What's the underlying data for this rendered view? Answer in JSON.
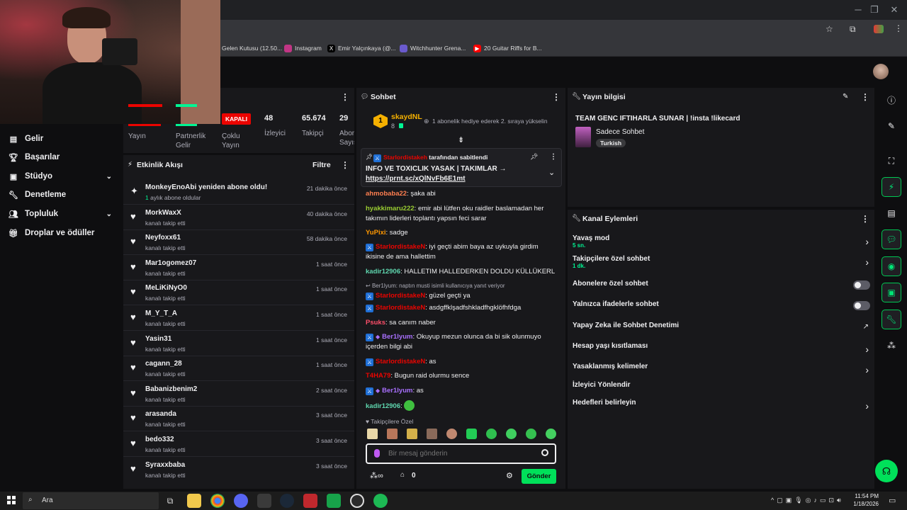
{
  "bookmarks": [
    "Gelen Kutusu (12.50...",
    "Instagram",
    "Emir Yalçınkaya (@...",
    "Witchhunter Grena...",
    "20 Guitar Riffs for B..."
  ],
  "nav": [
    {
      "label": "Gelir",
      "icon": "money-icon"
    },
    {
      "label": "Başarılar",
      "icon": "trophy-icon"
    },
    {
      "label": "Stüdyo",
      "icon": "studio-icon"
    },
    {
      "label": "Denetleme",
      "icon": "wrench-icon"
    },
    {
      "label": "Topluluk",
      "icon": "people-icon"
    },
    {
      "label": "Droplar ve ödüller",
      "icon": "gift-icon"
    }
  ],
  "stats": {
    "yayin_label": "Yayın",
    "partner_label": "Partnerlik Gelir",
    "multi_badge": "KAPALI",
    "multi_label": "Çoklu Yayın",
    "viewers_value": "48",
    "viewers_label": "İzleyici",
    "followers_value": "65.674",
    "followers_label": "Takipçi",
    "subs_value": "29",
    "subs_label": "Abon Sayıs"
  },
  "activity": {
    "title": "Etkinlik Akışı",
    "filter": "Filtre",
    "items": [
      {
        "name": "MonkeyEnoAbi yeniden abone oldu!",
        "sub": "1 aylık abone oldular",
        "time": "21 dakika önce"
      },
      {
        "name": "MorkWaxX",
        "sub": "kanalı takip etti",
        "time": "40 dakika önce"
      },
      {
        "name": "Neyfoxx61",
        "sub": "kanalı takip etti",
        "time": "58 dakika önce"
      },
      {
        "name": "Mar1ogomez07",
        "sub": "kanalı takip etti",
        "time": "1 saat önce"
      },
      {
        "name": "MeLiKiNyO0",
        "sub": "kanalı takip etti",
        "time": "1 saat önce"
      },
      {
        "name": "M_Y_T_A",
        "sub": "kanalı takip etti",
        "time": "1 saat önce"
      },
      {
        "name": "Yasin31",
        "sub": "kanalı takip etti",
        "time": "1 saat önce"
      },
      {
        "name": "cagann_28",
        "sub": "kanalı takip etti",
        "time": "1 saat önce"
      },
      {
        "name": "Babanizbenim2",
        "sub": "kanalı takip etti",
        "time": "2 saat önce"
      },
      {
        "name": "arasanda",
        "sub": "kanalı takip etti",
        "time": "3 saat önce"
      },
      {
        "name": "bedo332",
        "sub": "kanalı takip etti",
        "time": "3 saat önce"
      },
      {
        "name": "Syraxxbaba",
        "sub": "kanalı takip etti",
        "time": "3 saat önce"
      }
    ]
  },
  "chat": {
    "title": "Sohbet",
    "hype_rank": "1",
    "hype_user": "skaydNL",
    "hype_count": "8",
    "hype_text": "1 abonelik hediye ederek 2. sıraya yükselin",
    "pin_by": "Starlordistakeh",
    "pin_by_suffix": "tarafından sabitlendi",
    "pin_text": "INFO VE TOXICLIK YASAK | TAKIMLAR →",
    "pin_link": "https://prnt.sc/xQlNvFb6E1mt",
    "messages": [
      {
        "user": "ahmobaba22",
        "color": "#ff7f50",
        "badge": false,
        "text": "şaka abi"
      },
      {
        "user": "hyakkimaru222",
        "color": "#9acd32",
        "badge": false,
        "text": "emir abi lütfen oku raidler baslamadan her takımın liderleri toplantı yapsın feci sarar"
      },
      {
        "user": "YuPixi",
        "color": "#ff9800",
        "badge": false,
        "text": "sadge"
      },
      {
        "user": "StarlordistakeN",
        "color": "#eb0400",
        "badge": true,
        "text": "iyi geçti abim baya az uykuyla girdim ikisine de ama hallettim"
      },
      {
        "user": "kadir12906",
        "color": "#5fd7af",
        "badge": false,
        "text": "HALLETIM HALLEDERKEN DOLDU KÜLLÜKERL"
      },
      {
        "user": "StarlordistakeN",
        "color": "#eb0400",
        "badge": true,
        "text": "güzel geçti ya",
        "reply": "Ber1lyum: naptın musti isimli kullanıcıya yanıt veriyor"
      },
      {
        "user": "StarlordistakeN",
        "color": "#eb0400",
        "badge": true,
        "text": "asdgffklşadfshkladfhgklöfhfdga"
      },
      {
        "user": "Psuks",
        "color": "#ff4f6a",
        "badge": false,
        "text": "sa canım naber"
      },
      {
        "user": "Ber1lyum",
        "color": "#a970ff",
        "badge": true,
        "text": "Okuyup mezun olunca da bi sik olunmuyo içerden bilgi abi"
      },
      {
        "user": "StarlordistakeN",
        "color": "#eb0400",
        "badge": true,
        "text": "as"
      },
      {
        "user": "T4HA79",
        "color": "#eb0400",
        "badge": false,
        "text": "Bugun raid olurmu sence"
      },
      {
        "user": "Ber1lyum",
        "color": "#a970ff",
        "badge": true,
        "text": "as"
      },
      {
        "user": "kadir12906",
        "color": "#5fd7af",
        "badge": false,
        "text": ""
      }
    ],
    "follower_only": "Takipçilere Özel",
    "input_placeholder": "Bir mesaj gönderin",
    "points": "0",
    "send": "Gönder"
  },
  "stream_info": {
    "title": "Yayın bilgisi",
    "stream_title": "TEAM GENC IFTIHARLA SUNAR | !insta !likecard",
    "category": "Sadece Sohbet",
    "tag": "Turkish"
  },
  "channel_actions": {
    "title": "Kanal Eylemleri",
    "items": [
      {
        "label": "Yavaş mod",
        "sub": "5 sn.",
        "control": "arrow"
      },
      {
        "label": "Takipçilere özel sohbet",
        "sub": "1 dk.",
        "control": "arrow"
      },
      {
        "label": "Abonelere özel sohbet",
        "sub": "",
        "control": "toggle"
      },
      {
        "label": "Yalnızca ifadelerle sohbet",
        "sub": "",
        "control": "toggle"
      },
      {
        "label": "Yapay Zeka ile Sohbet Denetimi",
        "sub": "",
        "control": "external"
      },
      {
        "label": "Hesap yaşı kısıtlaması",
        "sub": "",
        "control": "arrow"
      },
      {
        "label": "Yasaklanmış kelimeler",
        "sub": "",
        "control": "arrow"
      },
      {
        "label": "İzleyici Yönlendir",
        "sub": "",
        "control": "none"
      },
      {
        "label": "Hedefleri belirleyin",
        "sub": "",
        "control": "arrow"
      }
    ]
  },
  "taskbar": {
    "search": "Ara",
    "time": "11:54 PM",
    "date": "1/18/2026"
  }
}
